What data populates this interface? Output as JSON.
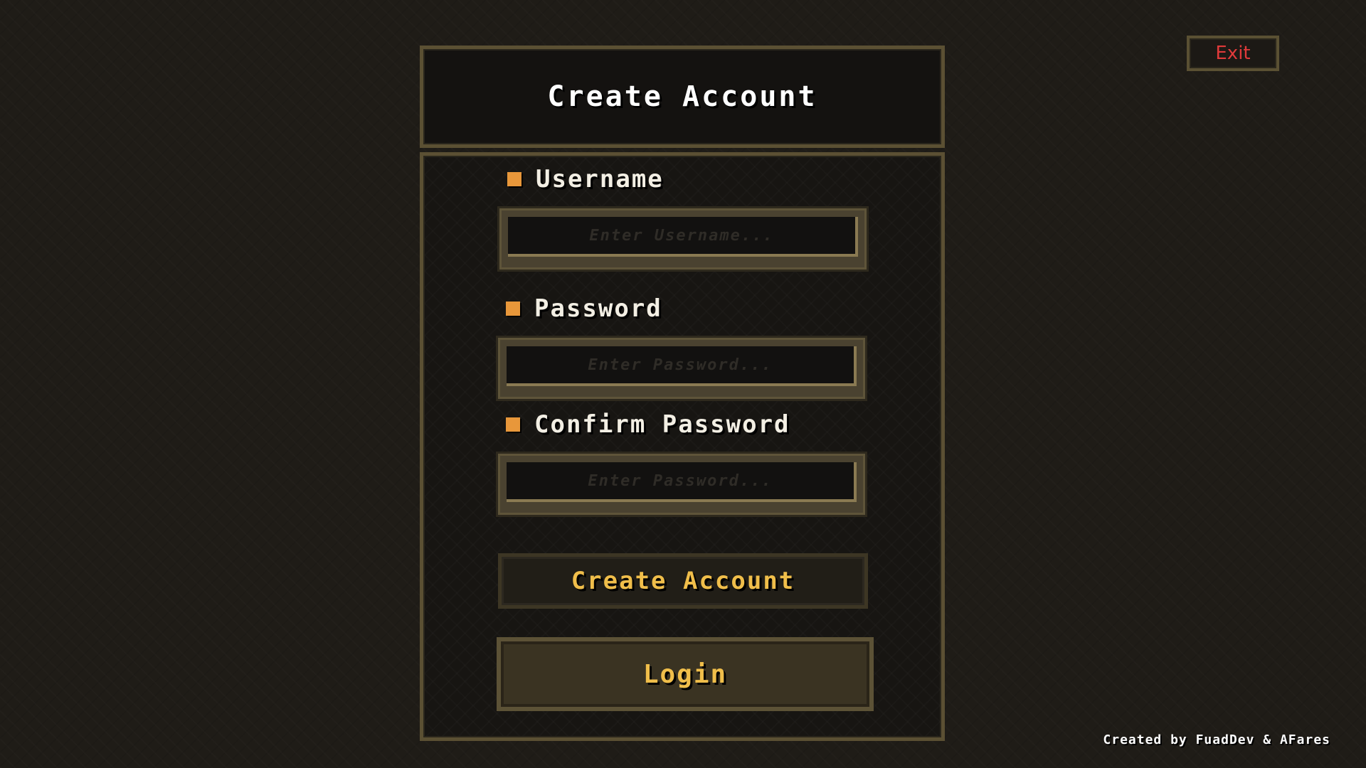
{
  "header": {
    "title": "Create Account"
  },
  "exit_button": {
    "label": "Exit"
  },
  "form": {
    "username": {
      "label": "Username",
      "value": "",
      "placeholder": "Enter Username..."
    },
    "password": {
      "label": "Password",
      "value": "",
      "placeholder": "Enter Password..."
    },
    "confirm_password": {
      "label": "Confirm Password",
      "value": "",
      "placeholder": "Enter Password..."
    }
  },
  "buttons": {
    "create_account": "Create Account",
    "login": "Login"
  },
  "footer": {
    "credits": "Created by FuadDev & AFares"
  },
  "colors": {
    "background": "#1f1c17",
    "panel": "#141210",
    "panel_border": "#5b5033",
    "bullet": "#e8973a",
    "button_text": "#f0be4a",
    "exit_text": "#e03a3a"
  },
  "icons": {
    "field_bullet": "orange-square-icon"
  }
}
